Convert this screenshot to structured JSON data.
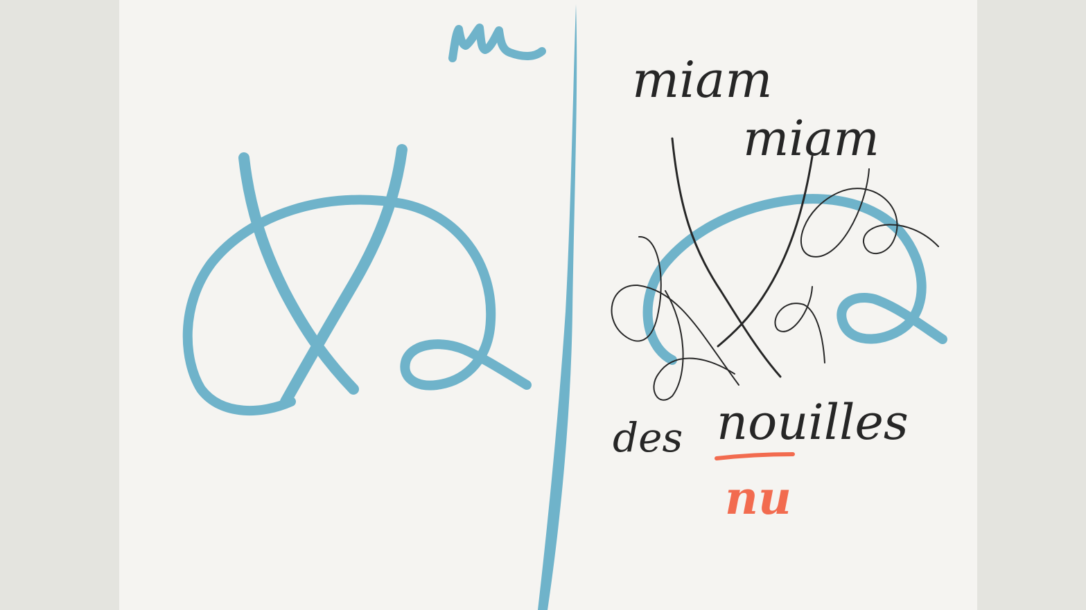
{
  "canvas": {
    "colors": {
      "background": "#e4e4df",
      "paper": "#f5f4f1",
      "blue_ink": "#6fb3ca",
      "black_ink": "#262626",
      "orange_ink": "#f26b4f"
    }
  },
  "left_panel": {
    "word": "nu"
  },
  "right_panel": {
    "words": {
      "line1": "miam",
      "line2": "miam",
      "line3_a": "des",
      "line3_b": "nouilles",
      "word_orange": "nu"
    }
  }
}
